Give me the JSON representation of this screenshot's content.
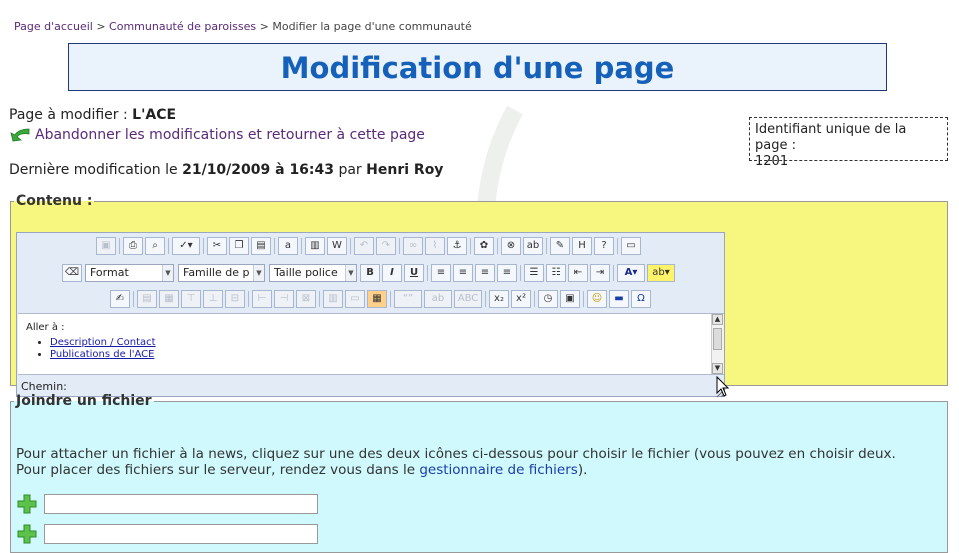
{
  "breadcrumb": {
    "items": [
      "Page d'accueil",
      "Communauté de paroisses",
      "Modifier la page d'une communauté"
    ],
    "separator": ">"
  },
  "page_title": "Modification d'une page",
  "page_info": {
    "label": "Page à modifier :",
    "value": "L'ACE",
    "back_link": "Abandonner les modifications et retourner à cette page",
    "lastmod_prefix": "Dernière modification le",
    "lastmod_date": "21/10/2009 à 16:43",
    "lastmod_by": "par",
    "lastmod_author": "Henri Roy",
    "id_label": "Identifiant unique de la page :",
    "id_value": "1201"
  },
  "contenu": {
    "legend": "Contenu :",
    "toolbar": {
      "format_label": "Format",
      "font_family_label": "Famille de p",
      "font_size_label": "Taille police"
    },
    "content": {
      "aller": "Aller à :",
      "links": [
        "Description / Contact",
        "Publications de l'ACE"
      ]
    },
    "path_label": "Chemin:"
  },
  "joindre": {
    "legend": "Joindre un fichier",
    "line1": "Pour attacher un fichier à la news, cliquez sur une des deux icônes ci-dessous pour choisir le fichier (vous pouvez en choisir deux.",
    "line2_prefix": "Pour placer des fichiers sur le serveur, rendez vous dans le",
    "line2_link": "gestionnaire de fichiers",
    "line2_suffix": ")."
  },
  "colors": {
    "title": "#1560b8",
    "contenu_bg": "#f7f780",
    "joindre_bg": "#cff9fc",
    "link": "#5a2a78",
    "plus_icon": "#3aa83a"
  }
}
